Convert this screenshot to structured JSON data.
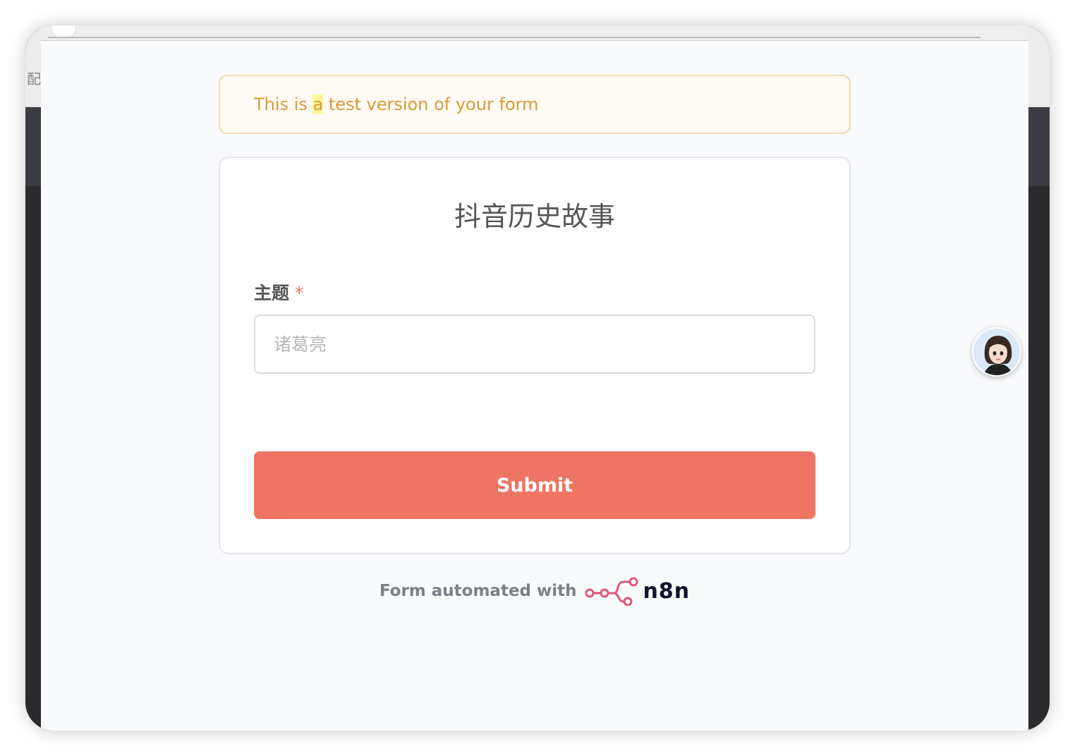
{
  "background": {
    "left_char": "配"
  },
  "banner": {
    "text_before": "This is ",
    "text_highlight": "a",
    "text_after": " test version of your form"
  },
  "form": {
    "title": "抖音历史故事",
    "field": {
      "label": "主题",
      "required_mark": "*",
      "placeholder": "诸葛亮",
      "value": ""
    },
    "submit_label": "Submit"
  },
  "footer": {
    "text": "Form automated with",
    "brand": "n8n"
  },
  "colors": {
    "accent": "#ee7564",
    "banner_text": "#d89a35",
    "brand_icon": "#e0577a"
  },
  "icons": {
    "n8n": "n8n-logo-icon",
    "assistant": "assistant-avatar-icon"
  }
}
